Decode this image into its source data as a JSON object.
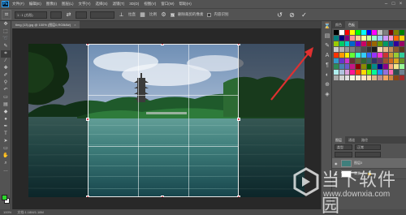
{
  "app": {
    "logo_text": "Ps",
    "menu": [
      "文件(F)",
      "编辑(E)",
      "图像(I)",
      "图层(L)",
      "文字(Y)",
      "选择(S)",
      "滤镜(T)",
      "3D(D)",
      "视图(V)",
      "窗口(W)",
      "帮助(H)"
    ]
  },
  "options": {
    "ratio_select": "1 : 1 (方形)",
    "straighten_label": "拉直",
    "overlay_label": "比例",
    "delete_pixels_label": "删除裁剪的像素",
    "content_aware_label": "内容识别",
    "delete_pixels_checked": true,
    "content_aware_checked": false
  },
  "document": {
    "tab_label": "timg (13).jpg @ 100% (图层0,RGB/8#)",
    "close_glyph": "×"
  },
  "panels": {
    "tabs_top": [
      "颜色",
      "色板"
    ],
    "tabs_layers": [
      "图层",
      "通道",
      "路径"
    ],
    "kind_select": "类型",
    "blend_select": "正常",
    "layers": [
      {
        "name": "图层0",
        "selected": true
      },
      {
        "name": "背景",
        "selected": false
      }
    ],
    "swatch_colors": [
      "#000000",
      "#ffffff",
      "#ff0000",
      "#ffff00",
      "#00ff00",
      "#00ffff",
      "#0000ff",
      "#ff00ff",
      "#c0c0c0",
      "#808080",
      "#800000",
      "#808000",
      "#008000",
      "#008080",
      "#000080",
      "#800080",
      "#ff9999",
      "#ffcc99",
      "#ffff99",
      "#ccff99",
      "#99ffcc",
      "#99ccff",
      "#cc99ff",
      "#ff99cc",
      "#ff6600",
      "#ffcc00",
      "#99cc00",
      "#00cc66",
      "#00cccc",
      "#0066cc",
      "#6600cc",
      "#cc0066",
      "#993300",
      "#996600",
      "#669900",
      "#009966",
      "#006699",
      "#330099",
      "#990066",
      "#cccccc",
      "#b3b3b3",
      "#999999",
      "#7f7f7f",
      "#666666",
      "#4c4c4c",
      "#333333",
      "#1a1a1a",
      "#f2d7b6",
      "#e6b98a",
      "#c68f5a",
      "#8c5a2c",
      "#5c3a1a",
      "#ff3300",
      "#ff9900",
      "#ffee00",
      "#66ff33",
      "#33ffcc",
      "#33ccff",
      "#3366ff",
      "#9933ff",
      "#ff33cc",
      "#cc3333",
      "#cc9933",
      "#99cc33",
      "#33cc99",
      "#3399cc",
      "#6633cc",
      "#cc33cc",
      "#663333",
      "#666633",
      "#336633",
      "#336666",
      "#333366",
      "#663366",
      "#a0522d",
      "#d2691e",
      "#daa520",
      "#6b8e23",
      "#2e8b57",
      "#4682b4",
      "#6a5acd",
      "#c71585",
      "#8b0000",
      "#8b8b00",
      "#006400",
      "#008b8b",
      "#00008b",
      "#8b008b",
      "#ffa07a",
      "#f0e68c",
      "#98fb98",
      "#afeeee",
      "#b0c4de",
      "#dda0dd",
      "#ff1493",
      "#ff4500",
      "#ffd700",
      "#7cfc00",
      "#00fa9a",
      "#1e90ff",
      "#9370db",
      "#ff69b4",
      "#2f4f4f",
      "#708090",
      "#a9a9a9",
      "#d3d3d3",
      "#e0e0e0",
      "#f5f5dc",
      "#faebd7",
      "#ffe4c4",
      "#ffdead",
      "#deb887",
      "#bc8f8f",
      "#f4a460",
      "#cd853f",
      "#8b4513",
      "#a52a2a"
    ]
  },
  "status": {
    "zoom": "100%",
    "doc_info": "文档:1.18M/1.18M"
  },
  "watermark": {
    "title": "当下软件园",
    "url": "www.downxia.com"
  },
  "colors": {
    "foreground": "#2bd82b",
    "background": "#ffffff",
    "arrow": "#e03030",
    "crop_handle": "#e84a5a"
  }
}
